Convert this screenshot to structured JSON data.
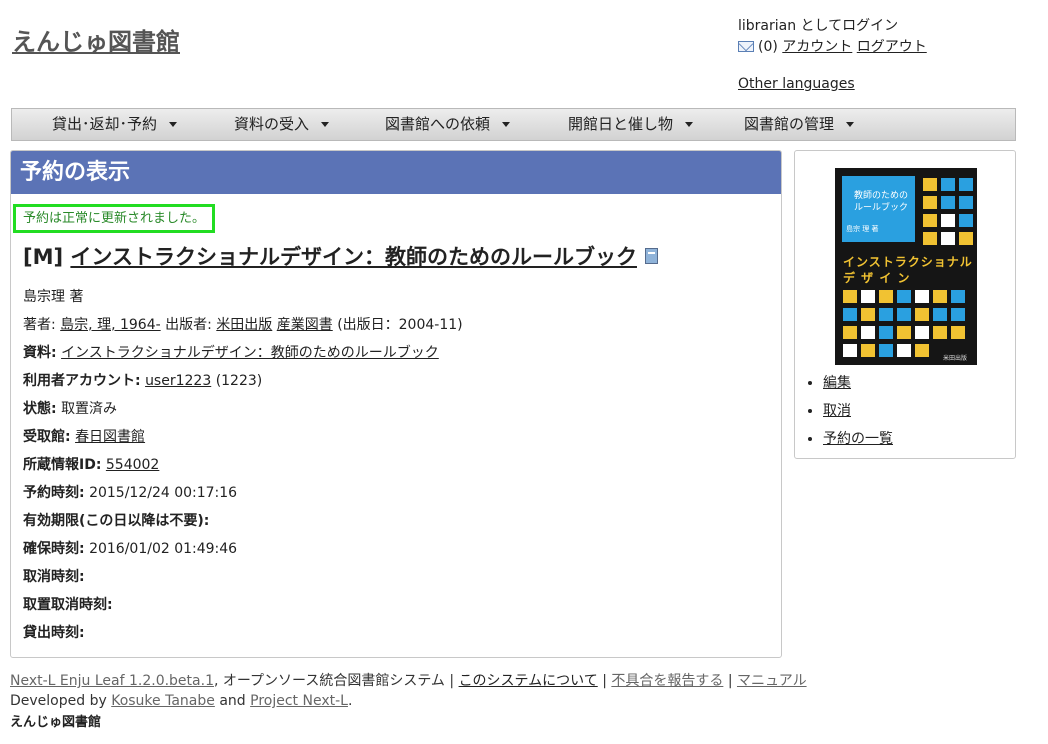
{
  "site": {
    "title": "えんじゅ図書館"
  },
  "header": {
    "login_text": "librarian としてログイン",
    "message_count": "(0)",
    "account_link": "アカウント",
    "logout_link": "ログアウト",
    "other_languages": "Other languages"
  },
  "nav": {
    "items": [
      {
        "label": "貸出･返却･予約"
      },
      {
        "label": "資料の受入"
      },
      {
        "label": "図書館への依頼"
      },
      {
        "label": "開館日と催し物"
      },
      {
        "label": "図書館の管理"
      }
    ]
  },
  "main": {
    "heading": "予約の表示",
    "notice": "予約は正常に更新されました。",
    "book": {
      "prefix": "[M]",
      "title": "インストラクショナルデザイン：教師のためのルールブック"
    },
    "statement": "島宗理 著",
    "creators": {
      "label": "著者:",
      "author_link": "島宗, 理, 1964-",
      "publisher_label": "出版者:",
      "publisher1": "米田出版",
      "publisher2": "産業図書",
      "pub_date": "(出版日：2004-11)"
    },
    "fields": {
      "manifestation_label": "資料:",
      "manifestation_link": "インストラクショナルデザイン：教師のためのルールブック",
      "user_label": "利用者アカウント:",
      "user_link": "user1223",
      "user_number": "(1223)",
      "state_label": "状態:",
      "state_value": "取置済み",
      "pickup_label": "受取館:",
      "pickup_link": "春日図書館",
      "item_label": "所蔵情報ID:",
      "item_link": "554002",
      "reserved_label": "予約時刻:",
      "reserved_value": "2015/12/24 00:17:16",
      "expire_label": "有効期限(この日以降は不要):",
      "retained_label": "確保時刻:",
      "retained_value": "2016/01/02 01:49:46",
      "canceled_label": "取消時刻:",
      "postponed_label": "取置取消時刻:",
      "checked_out_label": "貸出時刻:"
    }
  },
  "sidebar": {
    "cover": {
      "blue_text": "教師のための\nルールブック",
      "author": "島宗 理 著",
      "title_line1": "インストラクショナル",
      "title_line2": "デ ザ イ ン",
      "publisher": "米田出版"
    },
    "links": [
      {
        "label": "編集"
      },
      {
        "label": "取消"
      },
      {
        "label": "予約の一覧"
      }
    ]
  },
  "footer": {
    "product": "Next-L Enju Leaf 1.2.0.beta.1",
    "product_desc": ", オープンソース統合図書館システム",
    "about": "このシステムについて",
    "report": "不具合を報告する",
    "manual": "マニュアル",
    "developed_by": "Developed by",
    "dev_name": "Kosuke Tanabe",
    "and": "and",
    "project": "Project Next-L",
    "site_name": "えんじゅ図書館"
  },
  "colors": {
    "panel_header": "#5b73b6",
    "notice_border": "#22dd22",
    "notice_text": "#2a8a2a"
  }
}
